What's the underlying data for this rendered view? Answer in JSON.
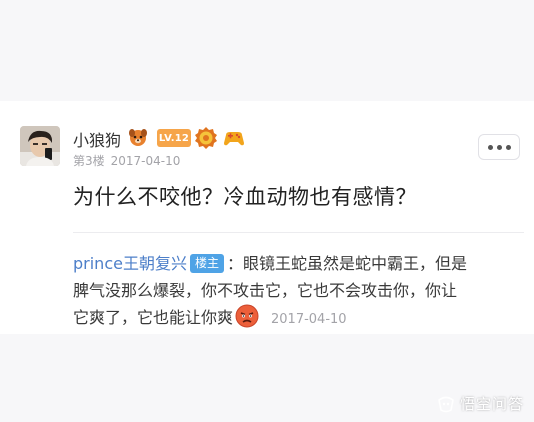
{
  "post": {
    "username": "小狼狗",
    "level_badge": "LV.12",
    "floor": "第3楼",
    "date": "2017-04-10",
    "content": "为什么不咬他？冷血动物也有感情？",
    "badges": [
      "dog-badge-icon",
      "level-badge",
      "gear-medal-icon",
      "gamepad-icon"
    ]
  },
  "reply": {
    "author": "prince王朝复兴",
    "op_tag": "楼主",
    "text_line1": "：眼镜王蛇虽然是蛇中霸王，但是",
    "text_line2": "脾气没那么爆裂，你不攻击它，它也不会攻击你，你让",
    "text_line3": "它爽了，它也能让你爽",
    "emoji": "angry-face-emoji",
    "date": "2017-04-10"
  },
  "watermark": "悟空问答",
  "colors": {
    "author_blue": "#4d7fc9",
    "op_tag_bg": "#4fa3e6",
    "level_badge_bg": "#f6a54a",
    "meta_gray": "#a3a3a8"
  }
}
